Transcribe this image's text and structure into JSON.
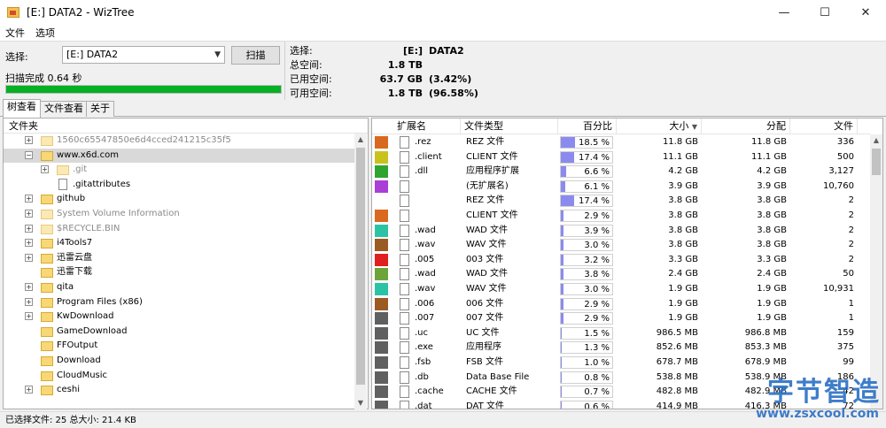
{
  "window": {
    "title": "[E:] DATA2  -  WizTree",
    "minimize": "—",
    "maximize": "☐",
    "close": "✕"
  },
  "menu": [
    "文件",
    "选项"
  ],
  "toolbar": {
    "select_label": "选择:",
    "drive_value": "[E:] DATA2",
    "scan_label": "扫描",
    "scan_status": "扫描完成 0.64 秒",
    "progress": 1.0
  },
  "info": {
    "selected_label": "选择:",
    "selected_value": "[E:]",
    "selected_extra": "DATA2",
    "total_label": "总空间:",
    "total_value": "1.8 TB",
    "used_label": "已用空间:",
    "used_value": "63.7 GB",
    "used_extra": "(3.42%)",
    "free_label": "可用空间:",
    "free_value": "1.8 TB",
    "free_extra": "(96.58%)"
  },
  "tabs": [
    "树查看",
    "文件查看",
    "关于"
  ],
  "tree": {
    "header": "文件夹",
    "rows": [
      {
        "label": "1560c65547850e6d4cced241215c35f5",
        "grey": true,
        "depth": 0,
        "type": "folder",
        "expander": "+"
      },
      {
        "label": "www.x6d.com",
        "grey": false,
        "depth": 0,
        "type": "folder",
        "expander": "−",
        "selected": true
      },
      {
        "label": ".git",
        "grey": true,
        "depth": 1,
        "type": "folder",
        "expander": "+"
      },
      {
        "label": ".gitattributes",
        "grey": false,
        "depth": 1,
        "type": "file",
        "expander": ""
      },
      {
        "label": "github",
        "grey": false,
        "depth": 0,
        "type": "folder",
        "expander": "+"
      },
      {
        "label": "System Volume Information",
        "grey": true,
        "depth": 0,
        "type": "folder",
        "expander": "+"
      },
      {
        "label": "$RECYCLE.BIN",
        "grey": true,
        "depth": 0,
        "type": "folder",
        "expander": "+"
      },
      {
        "label": "i4Tools7",
        "grey": false,
        "depth": 0,
        "type": "folder",
        "expander": "+"
      },
      {
        "label": "迅雷云盘",
        "grey": false,
        "depth": 0,
        "type": "folder",
        "expander": "+"
      },
      {
        "label": "迅雷下载",
        "grey": false,
        "depth": 0,
        "type": "folder",
        "expander": ""
      },
      {
        "label": "qita",
        "grey": false,
        "depth": 0,
        "type": "folder",
        "expander": "+"
      },
      {
        "label": "Program Files (x86)",
        "grey": false,
        "depth": 0,
        "type": "folder",
        "expander": "+"
      },
      {
        "label": "KwDownload",
        "grey": false,
        "depth": 0,
        "type": "folder",
        "expander": "+"
      },
      {
        "label": "GameDownload",
        "grey": false,
        "depth": 0,
        "type": "folder",
        "expander": ""
      },
      {
        "label": "FFOutput",
        "grey": false,
        "depth": 0,
        "type": "folder",
        "expander": ""
      },
      {
        "label": "Download",
        "grey": false,
        "depth": 0,
        "type": "folder",
        "expander": ""
      },
      {
        "label": "CloudMusic",
        "grey": false,
        "depth": 0,
        "type": "folder",
        "expander": ""
      },
      {
        "label": "ceshi",
        "grey": false,
        "depth": 0,
        "type": "folder",
        "expander": "+"
      }
    ]
  },
  "list": {
    "columns": [
      "扩展名",
      "文件类型",
      "百分比",
      "大小",
      "分配",
      "文件"
    ],
    "rows": [
      {
        "ext": ".rez",
        "type": "REZ 文件",
        "pct": 18.5,
        "pct_text": "18.5 %",
        "size": "11.8 GB",
        "alloc": "11.8 GB",
        "files": "336",
        "color": "#d9691e"
      },
      {
        "ext": ".client",
        "type": "CLIENT 文件",
        "pct": 17.4,
        "pct_text": "17.4 %",
        "size": "11.1 GB",
        "alloc": "11.1 GB",
        "files": "500",
        "color": "#c9c21d"
      },
      {
        "ext": ".dll",
        "type": "应用程序扩展",
        "pct": 6.6,
        "pct_text": "6.6 %",
        "size": "4.2 GB",
        "alloc": "4.2 GB",
        "files": "3,127",
        "color": "#2fa52f"
      },
      {
        "ext": "",
        "type": "(无扩展名)",
        "pct": 6.1,
        "pct_text": "6.1 %",
        "size": "3.9 GB",
        "alloc": "3.9 GB",
        "files": "10,760",
        "color": "#a93fd6"
      },
      {
        "ext": "",
        "type": "REZ 文件",
        "pct": 17.4,
        "pct_text": "17.4 %",
        "size": "3.8 GB",
        "alloc": "3.8 GB",
        "files": "2",
        "color": "#ffffff"
      },
      {
        "ext": "",
        "type": "CLIENT 文件",
        "pct": 2.9,
        "pct_text": "2.9 %",
        "size": "3.8 GB",
        "alloc": "3.8 GB",
        "files": "2",
        "color": "#d9691e"
      },
      {
        "ext": ".wad",
        "type": "WAD 文件",
        "pct": 3.9,
        "pct_text": "3.9 %",
        "size": "3.8 GB",
        "alloc": "3.8 GB",
        "files": "2",
        "color": "#2bc3a6"
      },
      {
        "ext": ".wav",
        "type": "WAV 文件",
        "pct": 3.0,
        "pct_text": "3.0 %",
        "size": "3.8 GB",
        "alloc": "3.8 GB",
        "files": "2",
        "color": "#9a5a22"
      },
      {
        "ext": ".005",
        "type": "003 文件",
        "pct": 3.2,
        "pct_text": "3.2 %",
        "size": "3.3 GB",
        "alloc": "3.3 GB",
        "files": "2",
        "color": "#e02020"
      },
      {
        "ext": ".wad",
        "type": "WAD 文件",
        "pct": 3.8,
        "pct_text": "3.8 %",
        "size": "2.4 GB",
        "alloc": "2.4 GB",
        "files": "50",
        "color": "#6ea33a"
      },
      {
        "ext": ".wav",
        "type": "WAV 文件",
        "pct": 3.0,
        "pct_text": "3.0 %",
        "size": "1.9 GB",
        "alloc": "1.9 GB",
        "files": "10,931",
        "color": "#2bc3a6"
      },
      {
        "ext": ".006",
        "type": "006 文件",
        "pct": 2.9,
        "pct_text": "2.9 %",
        "size": "1.9 GB",
        "alloc": "1.9 GB",
        "files": "1",
        "color": "#9a5a22"
      },
      {
        "ext": ".007",
        "type": "007 文件",
        "pct": 2.9,
        "pct_text": "2.9 %",
        "size": "1.9 GB",
        "alloc": "1.9 GB",
        "files": "1",
        "color": "#606060"
      },
      {
        "ext": ".uc",
        "type": "UC 文件",
        "pct": 1.5,
        "pct_text": "1.5 %",
        "size": "986.5 MB",
        "alloc": "986.8 MB",
        "files": "159",
        "color": "#606060"
      },
      {
        "ext": ".exe",
        "type": "应用程序",
        "pct": 1.3,
        "pct_text": "1.3 %",
        "size": "852.6 MB",
        "alloc": "853.3 MB",
        "files": "375",
        "color": "#606060"
      },
      {
        "ext": ".fsb",
        "type": "FSB 文件",
        "pct": 1.0,
        "pct_text": "1.0 %",
        "size": "678.7 MB",
        "alloc": "678.9 MB",
        "files": "99",
        "color": "#606060"
      },
      {
        "ext": ".db",
        "type": "Data Base File",
        "pct": 0.8,
        "pct_text": "0.8 %",
        "size": "538.8 MB",
        "alloc": "538.9 MB",
        "files": "186",
        "color": "#606060"
      },
      {
        "ext": ".cache",
        "type": "CACHE 文件",
        "pct": 0.7,
        "pct_text": "0.7 %",
        "size": "482.8 MB",
        "alloc": "482.9 MB",
        "files": "42",
        "color": "#606060"
      },
      {
        "ext": ".dat",
        "type": "DAT 文件",
        "pct": 0.6,
        "pct_text": "0.6 %",
        "size": "414.9 MB",
        "alloc": "416.3 MB",
        "files": "72",
        "color": "#606060"
      }
    ]
  },
  "status": {
    "text": "已选择文件: 25   总大小: 21.4 KB"
  },
  "watermark": {
    "cn": "字节智造",
    "url": "www.zsxcool.com"
  },
  "colors": {
    "progress": "#06b025",
    "selection": "#d9d9d9",
    "pct_bar": "#8b8bef",
    "folder": "#f8d775"
  }
}
